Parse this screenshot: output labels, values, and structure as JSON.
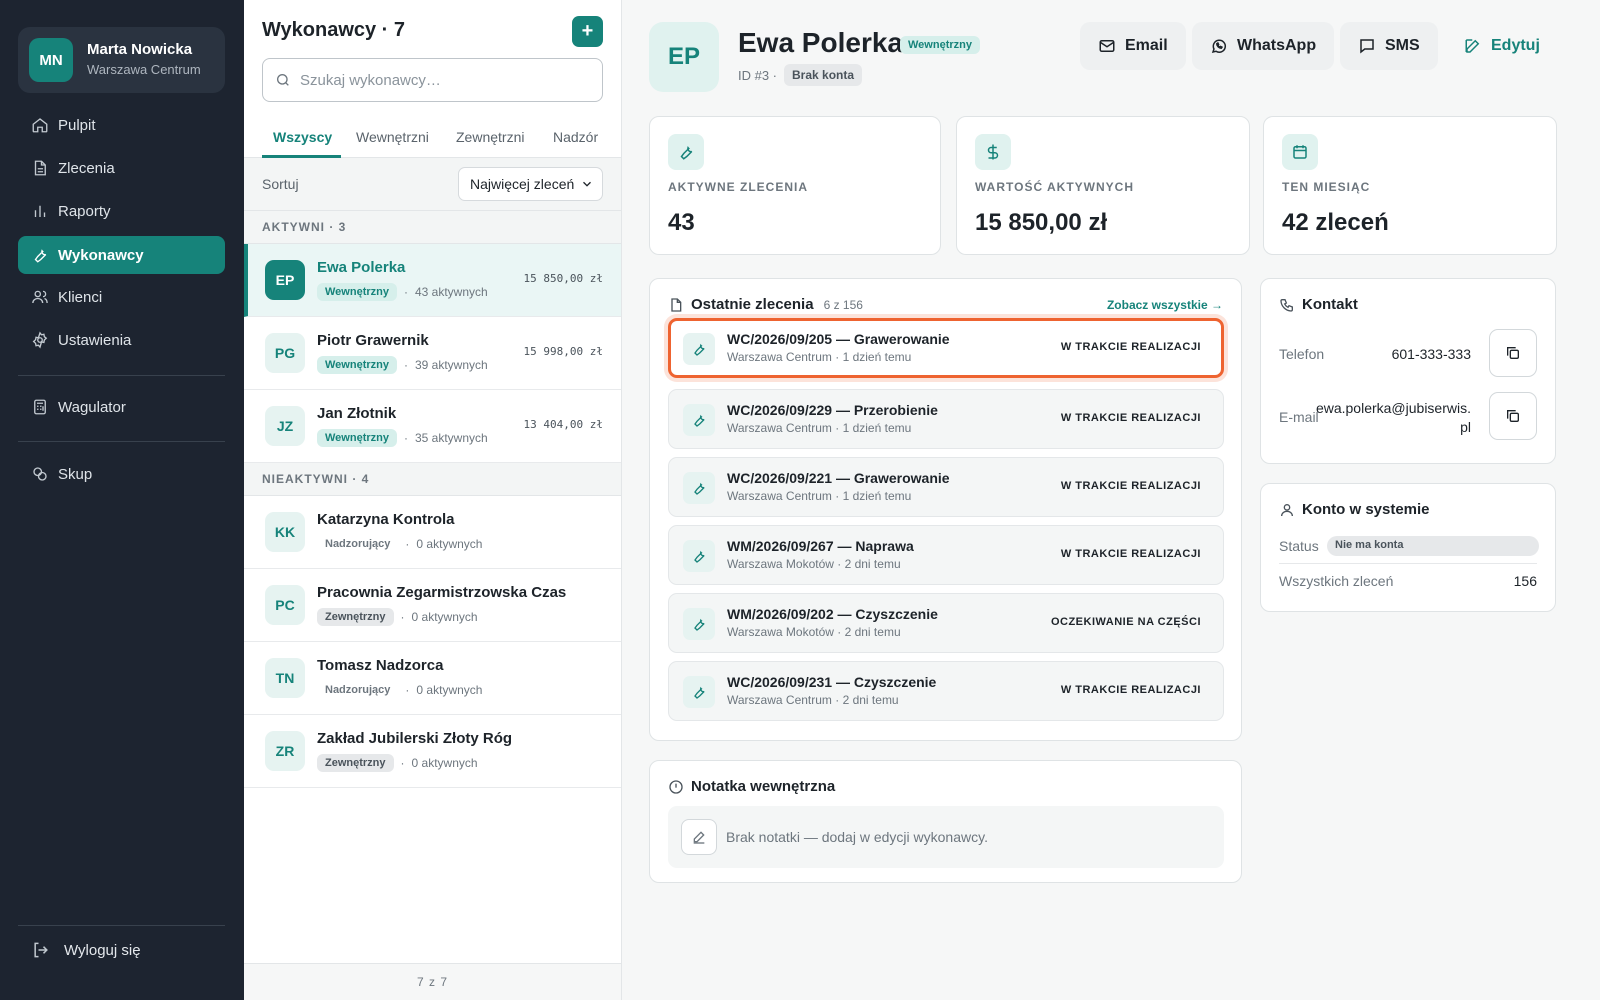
{
  "user": {
    "initials": "MN",
    "name": "Marta Nowicka",
    "location": "Warszawa Centrum"
  },
  "nav": {
    "items": [
      {
        "label": "Pulpit",
        "icon": "home-icon"
      },
      {
        "label": "Zlecenia",
        "icon": "document-icon"
      },
      {
        "label": "Raporty",
        "icon": "chart-icon"
      },
      {
        "label": "Wykonawcy",
        "icon": "wrench-icon",
        "active": true
      },
      {
        "label": "Klienci",
        "icon": "users-icon"
      },
      {
        "label": "Ustawienia",
        "icon": "gear-icon"
      }
    ],
    "wagulator": "Wagulator",
    "skup": "Skup",
    "logout": "Wyloguj się"
  },
  "list": {
    "title": "Wykonawcy · 7",
    "add_label": "+",
    "search_placeholder": "Szukaj wykonawcy…",
    "tabs": [
      "Wszyscy",
      "Wewnętrzni",
      "Zewnętrzni",
      "Nadzór"
    ],
    "sort_label": "Sortuj",
    "sort_value": "Najwięcej zleceń",
    "active_header": "AKTYWNI · 3",
    "inactive_header": "NIEAKTYWNI · 4",
    "active": [
      {
        "initials": "EP",
        "name": "Ewa Polerka",
        "type": "Wewnętrzny",
        "count": "43 aktywnych",
        "value": "15 850,00 zł",
        "selected": true
      },
      {
        "initials": "PG",
        "name": "Piotr Grawernik",
        "type": "Wewnętrzny",
        "count": "39 aktywnych",
        "value": "15 998,00 zł"
      },
      {
        "initials": "JZ",
        "name": "Jan Złotnik",
        "type": "Wewnętrzny",
        "count": "35 aktywnych",
        "value": "13 404,00 zł"
      }
    ],
    "inactive": [
      {
        "initials": "KK",
        "name": "Katarzyna Kontrola",
        "type": "Nadzorujący",
        "count": "0 aktywnych"
      },
      {
        "initials": "PC",
        "name": "Pracownia Zegarmistrzowska Czas",
        "type": "Zewnętrzny",
        "count": "0 aktywnych"
      },
      {
        "initials": "TN",
        "name": "Tomasz Nadzorca",
        "type": "Nadzorujący",
        "count": "0 aktywnych"
      },
      {
        "initials": "ZR",
        "name": "Zakład Jubilerski Złoty Róg",
        "type": "Zewnętrzny",
        "count": "0 aktywnych"
      }
    ],
    "footer": "7 z 7"
  },
  "detail": {
    "initials": "EP",
    "name": "Ewa Polerka",
    "type_badge": "Wewnętrzny",
    "id_text": "ID #3 ·",
    "account_badge": "Brak konta",
    "actions": {
      "email": "Email",
      "whatsapp": "WhatsApp",
      "sms": "SMS",
      "edit": "Edytuj"
    },
    "stats": [
      {
        "label": "AKTYWNE ZLECENIA",
        "value": "43",
        "icon": "wrench-icon"
      },
      {
        "label": "WARTOŚĆ AKTYWNYCH",
        "value": "15 850,00 zł",
        "icon": "dollar-icon"
      },
      {
        "label": "TEN MIESIĄC",
        "value": "42 zleceń",
        "icon": "calendar-icon"
      }
    ],
    "orders_title": "Ostatnie zlecenia",
    "orders_count": "6 z 156",
    "see_all": "Zobacz wszystkie →",
    "orders": [
      {
        "title": "WC/2026/09/205 — Grawerowanie",
        "sub": "Warszawa Centrum · 1 dzień temu",
        "status": "W TRAKCIE REALIZACJI",
        "highlighted": true
      },
      {
        "title": "WC/2026/09/229 — Przerobienie",
        "sub": "Warszawa Centrum · 1 dzień temu",
        "status": "W TRAKCIE REALIZACJI"
      },
      {
        "title": "WC/2026/09/221 — Grawerowanie",
        "sub": "Warszawa Centrum · 1 dzień temu",
        "status": "W TRAKCIE REALIZACJI"
      },
      {
        "title": "WM/2026/09/267 — Naprawa",
        "sub": "Warszawa Mokotów · 2 dni temu",
        "status": "W TRAKCIE REALIZACJI"
      },
      {
        "title": "WM/2026/09/202 — Czyszczenie",
        "sub": "Warszawa Mokotów · 2 dni temu",
        "status": "OCZEKIWANIE NA CZĘŚCI"
      },
      {
        "title": "WC/2026/09/231 — Czyszczenie",
        "sub": "Warszawa Centrum · 2 dni temu",
        "status": "W TRAKCIE REALIZACJI"
      }
    ],
    "note_title": "Notatka wewnętrzna",
    "note_text": "Brak notatki — dodaj w edycji wykonawcy.",
    "contact_title": "Kontakt",
    "phone_label": "Telefon",
    "phone_value": "601-333-333",
    "email_label": "E-mail",
    "email_value_line1": "ewa.polerka@jubiserwis.",
    "email_value_line2": "pl",
    "account_title": "Konto w systemie",
    "status_label": "Status",
    "status_value": "Nie ma konta",
    "all_orders_label": "Wszystkich zleceń",
    "all_orders_value": "156"
  },
  "colors": {
    "accent": "#16837a",
    "sidebar": "#1d2430",
    "highlight": "#ee6330"
  }
}
